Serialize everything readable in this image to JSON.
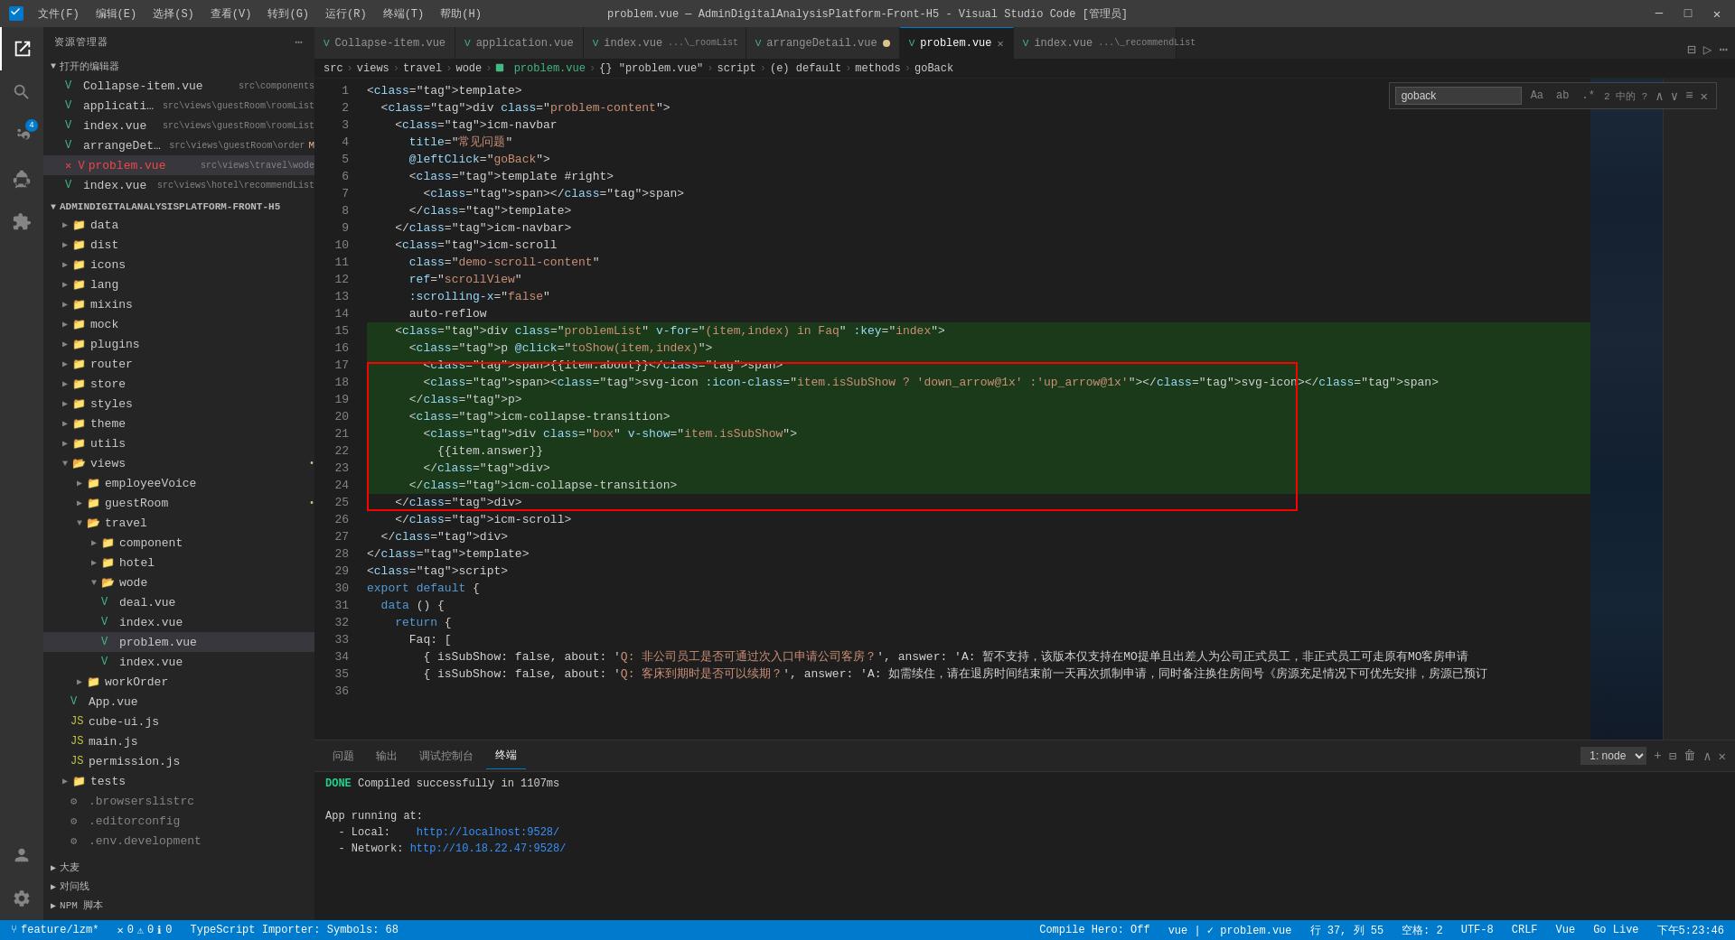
{
  "titleBar": {
    "title": "problem.vue — AdminDigitalAnalysisPlatform-Front-H5 - Visual Studio Code [管理员]",
    "menus": [
      "文件(F)",
      "编辑(E)",
      "选择(S)",
      "查看(V)",
      "转到(G)",
      "运行(R)",
      "终端(T)",
      "帮助(H)"
    ]
  },
  "activityBar": {
    "items": [
      {
        "name": "explorer",
        "icon": "⎗",
        "active": true
      },
      {
        "name": "search",
        "icon": "🔍"
      },
      {
        "name": "source-control",
        "icon": "⑂",
        "badge": "4"
      },
      {
        "name": "debug",
        "icon": "▷"
      },
      {
        "name": "extensions",
        "icon": "⊞"
      },
      {
        "name": "account",
        "icon": "👤",
        "bottom": true
      },
      {
        "name": "settings",
        "icon": "⚙",
        "bottom": true
      }
    ]
  },
  "sidebar": {
    "title": "资源管理器",
    "openFiles": {
      "label": "打开的编辑器",
      "items": [
        {
          "name": "Collapse-item.vue",
          "path": "src\\components",
          "icon": "V",
          "color": "#42b883"
        },
        {
          "name": "application.vue",
          "path": "src\\views\\guestRoom\\roomList",
          "icon": "V",
          "color": "#42b883"
        },
        {
          "name": "index.vue",
          "path": "src\\views\\guestRoom\\roomList",
          "icon": "V",
          "color": "#42b883"
        },
        {
          "name": "arrangeDetail.vue",
          "path": "src\\views\\guestRoom\\order",
          "icon": "V",
          "color": "#42b883",
          "modified": true
        },
        {
          "name": "problem.vue",
          "path": "src\\views\\travel\\wode",
          "icon": "V",
          "color": "#42b883",
          "active": true,
          "deleted": true
        },
        {
          "name": "index.vue",
          "path": "src\\views\\hotel\\recommendList",
          "icon": "V",
          "color": "#42b883"
        }
      ]
    },
    "projectName": "ADMINDIGITALANALYSISPLATFORM-FRONT-H5",
    "folders": [
      {
        "name": "data",
        "icon": "folder",
        "depth": 1
      },
      {
        "name": "dist",
        "icon": "folder",
        "depth": 1
      },
      {
        "name": "icons",
        "icon": "folder",
        "depth": 1
      },
      {
        "name": "lang",
        "icon": "folder",
        "depth": 1
      },
      {
        "name": "mixins",
        "icon": "folder",
        "depth": 1
      },
      {
        "name": "mock",
        "icon": "folder",
        "depth": 1
      },
      {
        "name": "plugins",
        "icon": "folder",
        "depth": 1
      },
      {
        "name": "router",
        "icon": "folder",
        "depth": 1
      },
      {
        "name": "store",
        "icon": "folder",
        "depth": 1
      },
      {
        "name": "styles",
        "icon": "folder",
        "depth": 1
      },
      {
        "name": "theme",
        "icon": "folder",
        "depth": 1
      },
      {
        "name": "utils",
        "icon": "folder",
        "depth": 1
      },
      {
        "name": "views",
        "icon": "folder-open",
        "depth": 1,
        "open": true
      },
      {
        "name": "employeeVoice",
        "icon": "folder",
        "depth": 2
      },
      {
        "name": "guestRoom",
        "icon": "folder",
        "depth": 2
      },
      {
        "name": "travel",
        "icon": "folder-open",
        "depth": 2,
        "open": true
      },
      {
        "name": "component",
        "icon": "folder",
        "depth": 3
      },
      {
        "name": "hotel",
        "icon": "folder",
        "depth": 3
      },
      {
        "name": "wode",
        "icon": "folder-open",
        "depth": 3,
        "open": true
      },
      {
        "name": "deal.vue",
        "icon": "file-vue",
        "depth": 4
      },
      {
        "name": "index.vue",
        "icon": "file-vue",
        "depth": 4
      },
      {
        "name": "problem.vue",
        "icon": "file-vue",
        "depth": 4,
        "active": true
      },
      {
        "name": "index.vue",
        "icon": "file-vue",
        "depth": 4
      },
      {
        "name": "workOrder",
        "icon": "folder",
        "depth": 2
      },
      {
        "name": "App.vue",
        "icon": "file-vue",
        "depth": 1
      },
      {
        "name": "cube-ui.js",
        "icon": "file-js",
        "depth": 1
      },
      {
        "name": "main.js",
        "icon": "file-js",
        "depth": 1
      },
      {
        "name": "permission.js",
        "icon": "file-js",
        "depth": 1
      },
      {
        "name": "tests",
        "icon": "folder",
        "depth": 1
      },
      {
        "name": ".browserslistrc",
        "icon": "dot-file",
        "depth": 1
      },
      {
        "name": ".editorconfig",
        "icon": "dot-file",
        "depth": 1
      },
      {
        "name": ".env.development",
        "icon": "dot-file",
        "depth": 1
      }
    ],
    "bottomItems": [
      {
        "name": "大麦",
        "icon": "▶"
      },
      {
        "name": "对问线",
        "icon": "▶"
      },
      {
        "name": "NPM 脚本",
        "icon": "▶"
      }
    ]
  },
  "tabs": [
    {
      "name": "Collapse-item.vue",
      "icon": "V",
      "active": false
    },
    {
      "name": "application.vue",
      "icon": "V",
      "active": false
    },
    {
      "name": "index.vue",
      "path": "...\\roomList",
      "icon": "V",
      "active": false
    },
    {
      "name": "arrangeDetail.vue",
      "icon": "V",
      "active": false,
      "modified": true
    },
    {
      "name": "problem.vue",
      "icon": "V",
      "active": true,
      "closeable": true
    },
    {
      "name": "index.vue",
      "path": "...\\recommendList",
      "icon": "V",
      "active": false
    }
  ],
  "breadcrumb": {
    "parts": [
      "src",
      "views",
      "travel",
      "wode",
      "problem.vue",
      "{}",
      "\"problem.vue\"",
      "script",
      "(e) default",
      "methods",
      "goBack"
    ]
  },
  "findWidget": {
    "value": "goback",
    "matchCase": "Aa",
    "wholeWord": "ab",
    "regex": ".*",
    "count": "2 中的 ?",
    "buttons": [
      "∧",
      "∨",
      "≡",
      "✕"
    ]
  },
  "codeLines": [
    {
      "n": 1,
      "code": "<template>"
    },
    {
      "n": 2,
      "code": "  <div class=\"problem-content\">"
    },
    {
      "n": 3,
      "code": "    <icm-navbar"
    },
    {
      "n": 4,
      "code": "      title=\"常见问题\""
    },
    {
      "n": 5,
      "code": "      @leftClick=\"goBack\">"
    },
    {
      "n": 6,
      "code": "      <template #right>"
    },
    {
      "n": 7,
      "code": "        <span></span>"
    },
    {
      "n": 8,
      "code": "      </template>"
    },
    {
      "n": 9,
      "code": "    </icm-navbar>"
    },
    {
      "n": 10,
      "code": "    <icm-scroll"
    },
    {
      "n": 11,
      "code": "      class=\"demo-scroll-content\""
    },
    {
      "n": 12,
      "code": "      ref=\"scrollView\""
    },
    {
      "n": 13,
      "code": "      :scrolling-x=\"false\""
    },
    {
      "n": 14,
      "code": "      auto-reflow"
    },
    {
      "n": 15,
      "code": ""
    },
    {
      "n": 16,
      "code": "    <div class=\"problemList\" v-for=\"(item,index) in Faq\" :key=\"index\">",
      "highlight": true
    },
    {
      "n": 17,
      "code": "      <p @click=\"toShow(item,index)\">",
      "highlight": true
    },
    {
      "n": 18,
      "code": "        <span>{{item.about}}</span>",
      "highlight": true
    },
    {
      "n": 19,
      "code": "        <span><svg-icon :icon-class=\"item.isSubShow ? 'down_arrow@1x' :'up_arrow@1x'\"></svg-icon></span>",
      "highlight": true
    },
    {
      "n": 20,
      "code": "      </p>",
      "highlight": true
    },
    {
      "n": 21,
      "code": "      <icm-collapse-transition>",
      "highlight": true
    },
    {
      "n": 22,
      "code": "        <div class=\"box\" v-show=\"item.isSubShow\">",
      "highlight": true
    },
    {
      "n": 23,
      "code": "          {{item.answer}}",
      "highlight": true
    },
    {
      "n": 24,
      "code": "        </div>",
      "highlight": true
    },
    {
      "n": 25,
      "code": "      </icm-collapse-transition>",
      "highlight": true
    },
    {
      "n": 26,
      "code": "    </div>"
    },
    {
      "n": 27,
      "code": "    </icm-scroll>"
    },
    {
      "n": 28,
      "code": "  </div>"
    },
    {
      "n": 29,
      "code": "</template>"
    },
    {
      "n": 30,
      "code": "<script>"
    },
    {
      "n": 31,
      "code": "export default {"
    },
    {
      "n": 32,
      "code": "  data () {"
    },
    {
      "n": 33,
      "code": "    return {"
    },
    {
      "n": 34,
      "code": "      Faq: ["
    },
    {
      "n": 35,
      "code": "        { isSubShow: false, about: 'Q: 非公司员工是否可通过次入口申请公司客房？', answer: 'A: 暂不支持，该版本仅支持在MO提单且出差人为公司正式员工，非正式员工可走原有MO客房申请"
    },
    {
      "n": 36,
      "code": "        { isSubShow: false, about: 'Q: 客床到期时是否可以续期？', answer: 'A: 如需续住，请在退房时间结束前一天再次抓制申请，同时备注换住房间号《房源充足情况下可优先安排，房源已预订"
    }
  ],
  "bottomPanel": {
    "tabs": [
      "问题",
      "输出",
      "调试控制台",
      "终端"
    ],
    "activeTab": "终端",
    "terminalContent": [
      {
        "text": "DONE  Compiled successfully in 1107ms",
        "type": "done"
      },
      {
        "text": ""
      },
      {
        "text": "App running at:"
      },
      {
        "text": "  - Local:   http://localhost:9528/",
        "type": "link"
      },
      {
        "text": "  - Network: http://10.18.22.47:9528/",
        "type": "link"
      }
    ],
    "terminalSelector": "1: node"
  },
  "statusBar": {
    "branch": "feature/lzm*",
    "errors": "0",
    "warnings": "0",
    "info": "0",
    "line": "37",
    "col": "55",
    "spaces": "空格: 2",
    "encoding": "UTF-8",
    "lineEnding": "CRLF",
    "language": "Vue",
    "linter": "Go Live",
    "rightItems": [
      "Compile Hero: Off",
      "行 37, 列 55",
      "空格: 2",
      "UTF-8",
      "CRLF",
      "Vue",
      "Go Live"
    ],
    "leftExtra": "TypeScript Importer: Symbols: 68",
    "vueStatus": "vue | ✓ problem.vue"
  }
}
